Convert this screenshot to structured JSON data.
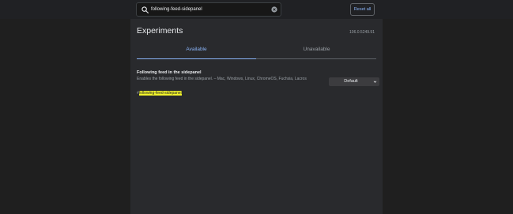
{
  "search": {
    "value": "following-feed-sidepanel"
  },
  "header": {
    "reset_label": "Reset all"
  },
  "main": {
    "title": "Experiments",
    "version": "106.0.5249.91",
    "tabs": [
      {
        "label": "Available",
        "selected": true
      },
      {
        "label": "Unavailable",
        "selected": false
      }
    ]
  },
  "flag": {
    "title": "Following feed in the sidepanel",
    "description": "Enables the following feed in the sidepanel. – Mac, Windows, Linux, ChromeOS, Fuchsia, Lacros",
    "anchor_prefix": "#",
    "anchor": "following-feed-sidepanel",
    "select_value": "Default"
  },
  "colors": {
    "accent": "#8ab4f8",
    "highlight": "#f1f32c",
    "panel": "#292a2d",
    "background": "#1f1f1f"
  },
  "icons": [
    "search-icon",
    "clear-icon",
    "chevron-down-icon"
  ]
}
